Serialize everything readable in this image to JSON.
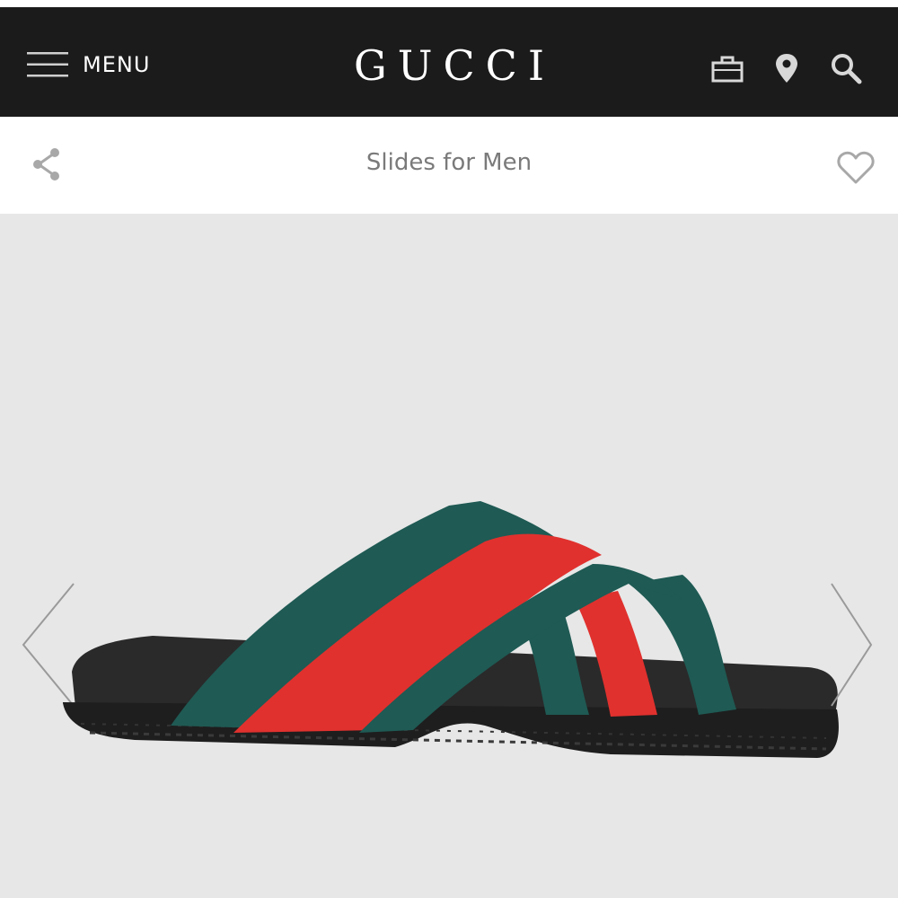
{
  "header": {
    "menu_label": "MENU",
    "brand": "GUCCI",
    "icons": [
      "menu-icon",
      "shopping-bag-icon",
      "location-pin-icon",
      "search-icon"
    ]
  },
  "subheader": {
    "title": "Slides for Men",
    "icons": [
      "share-icon",
      "heart-icon"
    ]
  },
  "gallery": {
    "product_image": "sandal-image",
    "nav_icons": [
      "chevron-left-icon",
      "chevron-right-icon"
    ]
  },
  "colors": {
    "header_bg": "#1b1b1b",
    "page_bg": "#e7e7e7",
    "strap_green": "#1f5a54",
    "strap_red": "#e0312e",
    "sole": "#1e1e1e"
  }
}
